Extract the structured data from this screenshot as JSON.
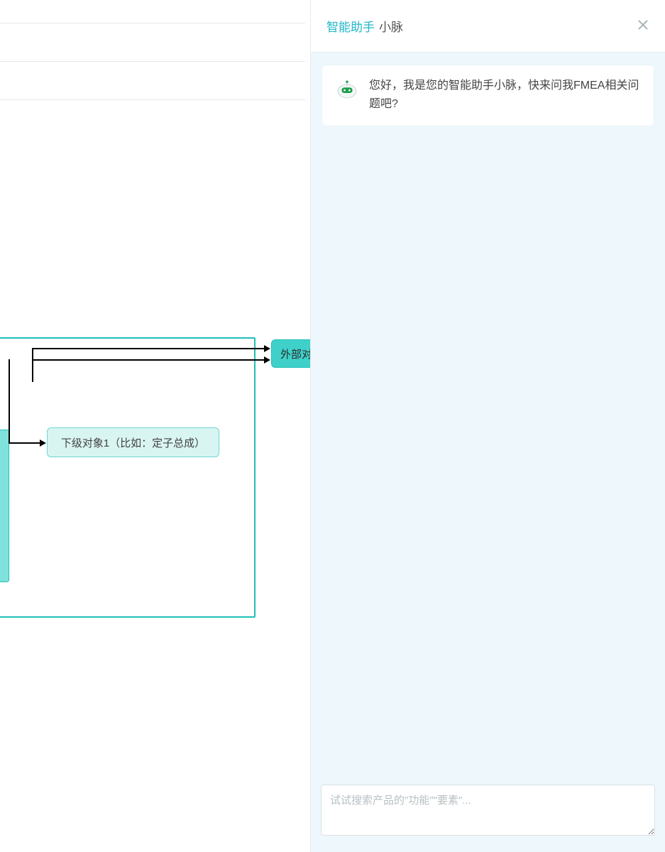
{
  "assistant": {
    "title_primary": "智能助手",
    "title_secondary": "小脉",
    "greeting": "您好，我是您的智能助手小脉，快来问我FMEA相关问题吧?",
    "input_placeholder": "试试搜索产品的\"功能\"\"要素\"..."
  },
  "diagram": {
    "sub_node_label": "下级对象1（比如：定子总成）",
    "ext_node_label": "外部对"
  }
}
